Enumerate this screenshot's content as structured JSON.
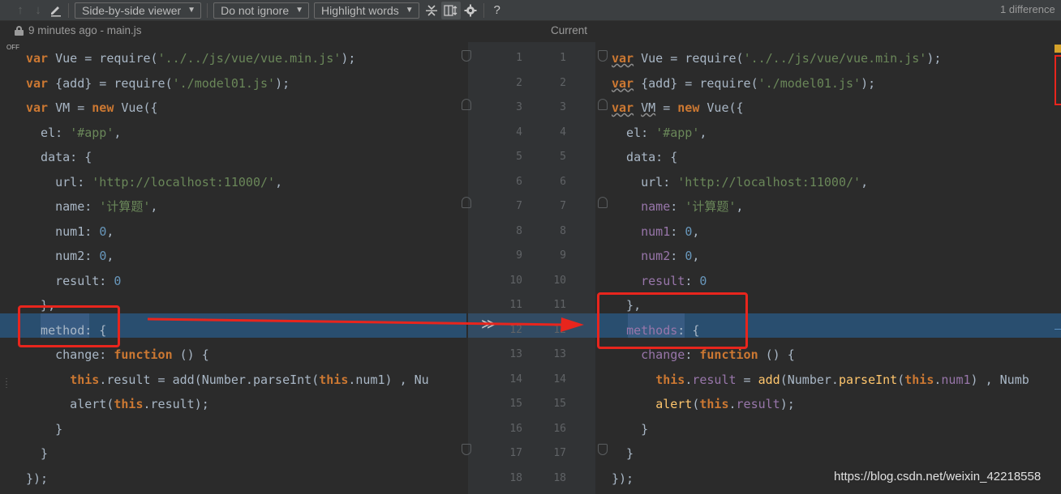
{
  "toolbar": {
    "viewer_mode": "Side-by-side viewer",
    "ignore_mode": "Do not ignore",
    "highlight_mode": "Highlight words",
    "help": "?",
    "difference_count": "1 difference"
  },
  "header": {
    "left_label": "9 minutes ago - main.js",
    "right_label": "Current"
  },
  "editor": {
    "sync_scroll_toggle": "OFF",
    "line_numbers": [
      "1",
      "2",
      "3",
      "4",
      "5",
      "6",
      "7",
      "8",
      "9",
      "10",
      "11",
      "12",
      "13",
      "14",
      "15",
      "16",
      "17",
      "18"
    ],
    "left_lines": [
      [
        [
          "kw",
          "var"
        ],
        [
          "plain",
          " Vue = require("
        ],
        [
          "str",
          "'../../js/vue/vue.min.js'"
        ],
        [
          "plain",
          ");"
        ]
      ],
      [
        [
          "kw",
          "var"
        ],
        [
          "plain",
          " {add} = require("
        ],
        [
          "str",
          "'./model01.js'"
        ],
        [
          "plain",
          ");"
        ]
      ],
      [
        [
          "kw",
          "var"
        ],
        [
          "plain",
          " VM = "
        ],
        [
          "kw",
          "new"
        ],
        [
          "plain",
          " Vue({"
        ]
      ],
      [
        [
          "plain",
          "  el: "
        ],
        [
          "str",
          "'#app'"
        ],
        [
          "plain",
          ","
        ]
      ],
      [
        [
          "plain",
          "  data: {"
        ]
      ],
      [
        [
          "plain",
          "    url: "
        ],
        [
          "str",
          "'http://localhost:11000/'"
        ],
        [
          "plain",
          ","
        ]
      ],
      [
        [
          "plain",
          "    name: "
        ],
        [
          "str",
          "'计算题'"
        ],
        [
          "plain",
          ","
        ]
      ],
      [
        [
          "plain",
          "    num1: "
        ],
        [
          "num",
          "0"
        ],
        [
          "plain",
          ","
        ]
      ],
      [
        [
          "plain",
          "    num2: "
        ],
        [
          "num",
          "0"
        ],
        [
          "plain",
          ","
        ]
      ],
      [
        [
          "plain",
          "    result: "
        ],
        [
          "num",
          "0"
        ]
      ],
      [
        [
          "plain",
          "  },"
        ]
      ],
      [
        [
          "plain",
          "  method: {"
        ]
      ],
      [
        [
          "plain",
          "    change: "
        ],
        [
          "kw",
          "function"
        ],
        [
          "plain",
          " () {"
        ]
      ],
      [
        [
          "plain",
          "      "
        ],
        [
          "kw",
          "this"
        ],
        [
          "plain",
          ".result = add(Number.parseInt("
        ],
        [
          "kw",
          "this"
        ],
        [
          "plain",
          ".num1) , Nu"
        ]
      ],
      [
        [
          "plain",
          "      alert("
        ],
        [
          "kw",
          "this"
        ],
        [
          "plain",
          ".result);"
        ]
      ],
      [
        [
          "plain",
          "    }"
        ]
      ],
      [
        [
          "plain",
          "  }"
        ]
      ],
      [
        [
          "plain",
          "});"
        ]
      ]
    ],
    "right_lines": [
      [
        [
          "kw u",
          "var"
        ],
        [
          "plain",
          " Vue = require("
        ],
        [
          "str",
          "'../../js/vue/vue.min.js'"
        ],
        [
          "plain",
          ");"
        ]
      ],
      [
        [
          "kw u",
          "var"
        ],
        [
          "plain",
          " {add} = require("
        ],
        [
          "str",
          "'./model01.js'"
        ],
        [
          "plain",
          ");"
        ]
      ],
      [
        [
          "kw u",
          "var"
        ],
        [
          "plain",
          " "
        ],
        [
          "plain u",
          "VM"
        ],
        [
          "plain",
          " = "
        ],
        [
          "kw",
          "new"
        ],
        [
          "plain",
          " Vue({"
        ]
      ],
      [
        [
          "plain",
          "  el: "
        ],
        [
          "str",
          "'#app'"
        ],
        [
          "plain",
          ","
        ]
      ],
      [
        [
          "plain",
          "  data: {"
        ]
      ],
      [
        [
          "plain",
          "    url: "
        ],
        [
          "str",
          "'http://localhost:11000/'"
        ],
        [
          "plain",
          ","
        ]
      ],
      [
        [
          "plain",
          "    "
        ],
        [
          "prop",
          "name"
        ],
        [
          "plain",
          ": "
        ],
        [
          "str",
          "'计算题'"
        ],
        [
          "plain",
          ","
        ]
      ],
      [
        [
          "plain",
          "    "
        ],
        [
          "prop",
          "num1"
        ],
        [
          "plain",
          ": "
        ],
        [
          "num",
          "0"
        ],
        [
          "plain",
          ","
        ]
      ],
      [
        [
          "plain",
          "    "
        ],
        [
          "prop",
          "num2"
        ],
        [
          "plain",
          ": "
        ],
        [
          "num",
          "0"
        ],
        [
          "plain",
          ","
        ]
      ],
      [
        [
          "plain",
          "    "
        ],
        [
          "prop",
          "result"
        ],
        [
          "plain",
          ": "
        ],
        [
          "num",
          "0"
        ]
      ],
      [
        [
          "plain",
          "  },"
        ]
      ],
      [
        [
          "plain",
          "  "
        ],
        [
          "prop",
          "methods"
        ],
        [
          "plain",
          ": {"
        ]
      ],
      [
        [
          "plain",
          "    "
        ],
        [
          "prop",
          "change"
        ],
        [
          "plain",
          ": "
        ],
        [
          "kw",
          "function"
        ],
        [
          "plain",
          " () {"
        ]
      ],
      [
        [
          "plain",
          "      "
        ],
        [
          "kw",
          "this"
        ],
        [
          "plain",
          "."
        ],
        [
          "prop",
          "result"
        ],
        [
          "plain",
          " = "
        ],
        [
          "fn",
          "add"
        ],
        [
          "plain",
          "(Number."
        ],
        [
          "fn",
          "parseInt"
        ],
        [
          "plain",
          "("
        ],
        [
          "kw",
          "this"
        ],
        [
          "plain",
          "."
        ],
        [
          "prop",
          "num1"
        ],
        [
          "plain",
          ") , Numb"
        ]
      ],
      [
        [
          "plain",
          "      "
        ],
        [
          "fn",
          "alert"
        ],
        [
          "plain",
          "("
        ],
        [
          "kw",
          "this"
        ],
        [
          "plain",
          "."
        ],
        [
          "prop",
          "result"
        ],
        [
          "plain",
          ");"
        ]
      ],
      [
        [
          "plain",
          "    }"
        ]
      ],
      [
        [
          "plain",
          "  }"
        ]
      ],
      [
        [
          "plain",
          "});"
        ]
      ]
    ]
  },
  "watermark": "https://blog.csdn.net/weixin_42218558",
  "colors": {
    "background": "#2b2b2b",
    "modified": "#294e6f",
    "annotation_red": "#e8251d"
  }
}
